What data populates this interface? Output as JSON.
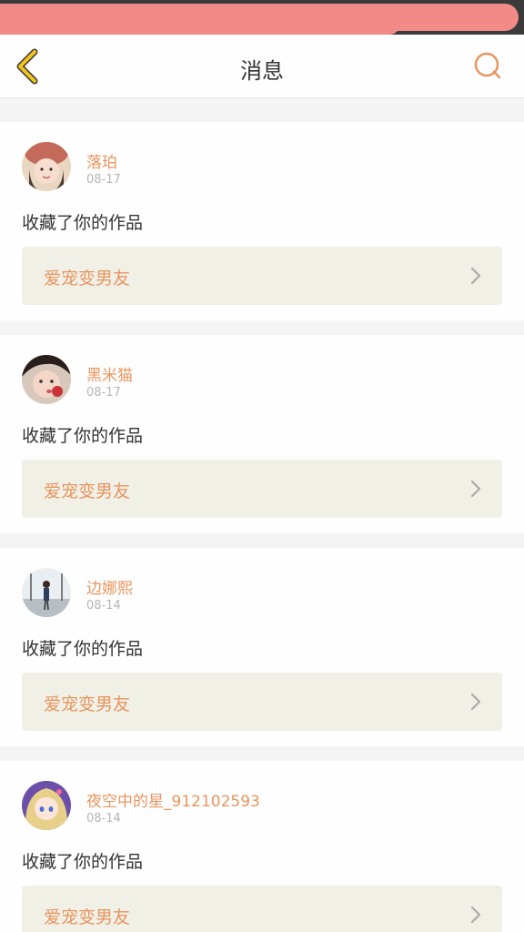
{
  "header": {
    "title": "消息"
  },
  "icons": {
    "back": "chevron-left-icon",
    "search": "search-icon",
    "go": "chevron-right-icon"
  },
  "colors": {
    "accent": "#e8955f",
    "back_icon": "#f2c21b",
    "card_link_bg": "#f0f0e6"
  },
  "messages": [
    {
      "username": "落珀",
      "date": "08-17",
      "action": "收藏了你的作品",
      "work_title": "爱宠变男友"
    },
    {
      "username": "黑米猫",
      "date": "08-17",
      "action": "收藏了你的作品",
      "work_title": "爱宠变男友"
    },
    {
      "username": "边娜熙",
      "date": "08-14",
      "action": "收藏了你的作品",
      "work_title": "爱宠变男友"
    },
    {
      "username": "夜空中的星_912102593",
      "date": "08-14",
      "action": "收藏了你的作品",
      "work_title": "爱宠变男友"
    }
  ]
}
